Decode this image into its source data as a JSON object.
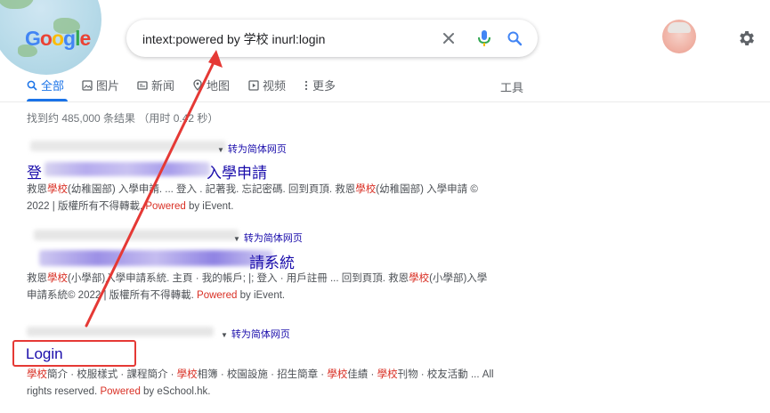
{
  "logo": {
    "text": "Google"
  },
  "search": {
    "query": "intext:powered by 学校 inurl:login"
  },
  "tabs": [
    {
      "label": "全部",
      "icon": "search-icon"
    },
    {
      "label": "图片",
      "icon": "image-icon"
    },
    {
      "label": "新闻",
      "icon": "newspaper-icon"
    },
    {
      "label": "地图",
      "icon": "map-pin-icon"
    },
    {
      "label": "视频",
      "icon": "play-icon"
    },
    {
      "label": "更多",
      "icon": "more-vert-icon"
    }
  ],
  "tools_label": "工具",
  "stats": "找到约 485,000 条结果 （用时 0.42 秒）",
  "translate_label": "转为简体网页",
  "results": [
    {
      "title_start": "登",
      "title_end": "入學申請",
      "snippet": [
        {
          "t": "救恩"
        },
        {
          "t": "學校",
          "h": true
        },
        {
          "t": "(幼稚園部) 入學申請. ... 登入 . 記著我. 忘記密碼. 回到頁頂. 救恩"
        },
        {
          "t": "學校",
          "h": true
        },
        {
          "t": "(幼稚園部) 入學申請 © 2022 | 版權所有不得轉載. "
        },
        {
          "t": "Powered",
          "h": true
        },
        {
          "t": " by iEvent."
        }
      ]
    },
    {
      "url_fragment": ".ievent.hk",
      "title_end": "請系統",
      "snippet": [
        {
          "t": "救恩"
        },
        {
          "t": "學校",
          "h": true
        },
        {
          "t": "(小學部)入學申請系統. 主頁 · 我的帳戶; |; 登入 · 用戶註冊 ... 回到頁頂. 救恩"
        },
        {
          "t": "學校",
          "h": true
        },
        {
          "t": "(小學部)入學申請系統© 2022 | 版權所有不得轉載. "
        },
        {
          "t": "Powered",
          "h": true
        },
        {
          "t": " by iEvent."
        }
      ]
    },
    {
      "title": "Login",
      "snippet": [
        {
          "t": "學校",
          "h": true
        },
        {
          "t": "簡介 · 校服樣式 · 課程簡介 · "
        },
        {
          "t": "學校",
          "h": true
        },
        {
          "t": "相簿 · 校園設施 · 招生簡章 · "
        },
        {
          "t": "學校",
          "h": true
        },
        {
          "t": "佳績 · "
        },
        {
          "t": "學校",
          "h": true
        },
        {
          "t": "刊物 · 校友活動 ... All rights reserved. "
        },
        {
          "t": "Powered",
          "h": true
        },
        {
          "t": " by eSchool.hk."
        }
      ]
    }
  ],
  "colors": {
    "link": "#1a0dab",
    "highlight": "#d93025",
    "annotation": "#e53935",
    "accent": "#1a73e8"
  }
}
